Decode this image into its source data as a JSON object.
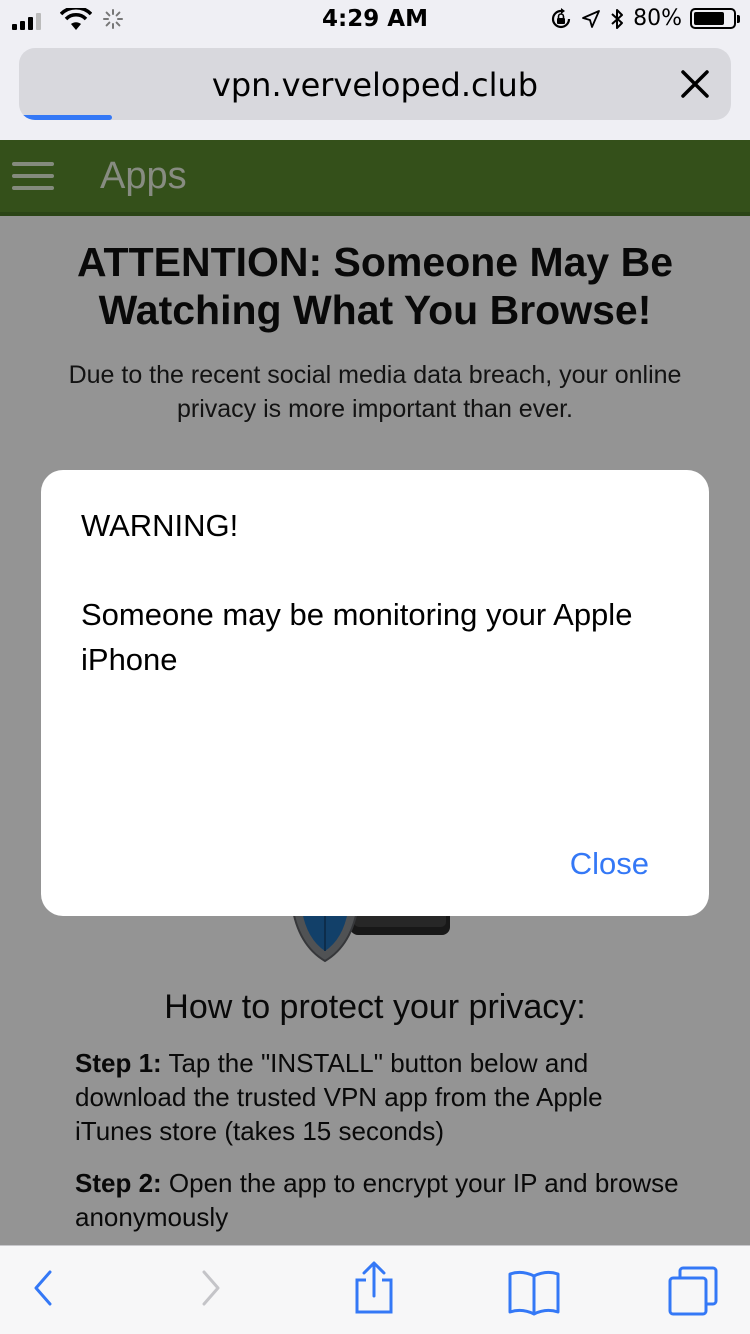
{
  "status_bar": {
    "time": "4:29 AM",
    "battery_percent": "80%",
    "battery_level": 0.8
  },
  "browser": {
    "url": "vpn.verveloped.club",
    "load_progress": 0.13
  },
  "page": {
    "app_title": "Apps",
    "headline": "ATTENTION: Someone May Be Watching What You Browse!",
    "intro": "Due to the recent social media data breach, your online privacy is more important than ever.",
    "how_title": "How to protect your privacy:",
    "steps": [
      {
        "label": "Step 1:",
        "text": " Tap the \"INSTALL\" button below and download the trusted VPN app from the Apple iTunes store (takes 15 seconds)"
      },
      {
        "label": "Step 2:",
        "text": " Open the app to encrypt your IP and browse anonymously"
      }
    ]
  },
  "alert": {
    "title": "WARNING!",
    "message": "Someone may be monitoring your Apple iPhone",
    "close_label": "Close"
  },
  "colors": {
    "accent": "#3478f6",
    "appbar": "#5a8a2e"
  },
  "icons": [
    "signal-icon",
    "wifi-icon",
    "activity-spinner-icon",
    "orientation-lock-icon",
    "location-icon",
    "bluetooth-icon",
    "battery-icon",
    "close-icon",
    "back-icon",
    "forward-icon",
    "share-icon",
    "bookmarks-icon",
    "tabs-icon",
    "menu-icon",
    "shield-icon"
  ]
}
